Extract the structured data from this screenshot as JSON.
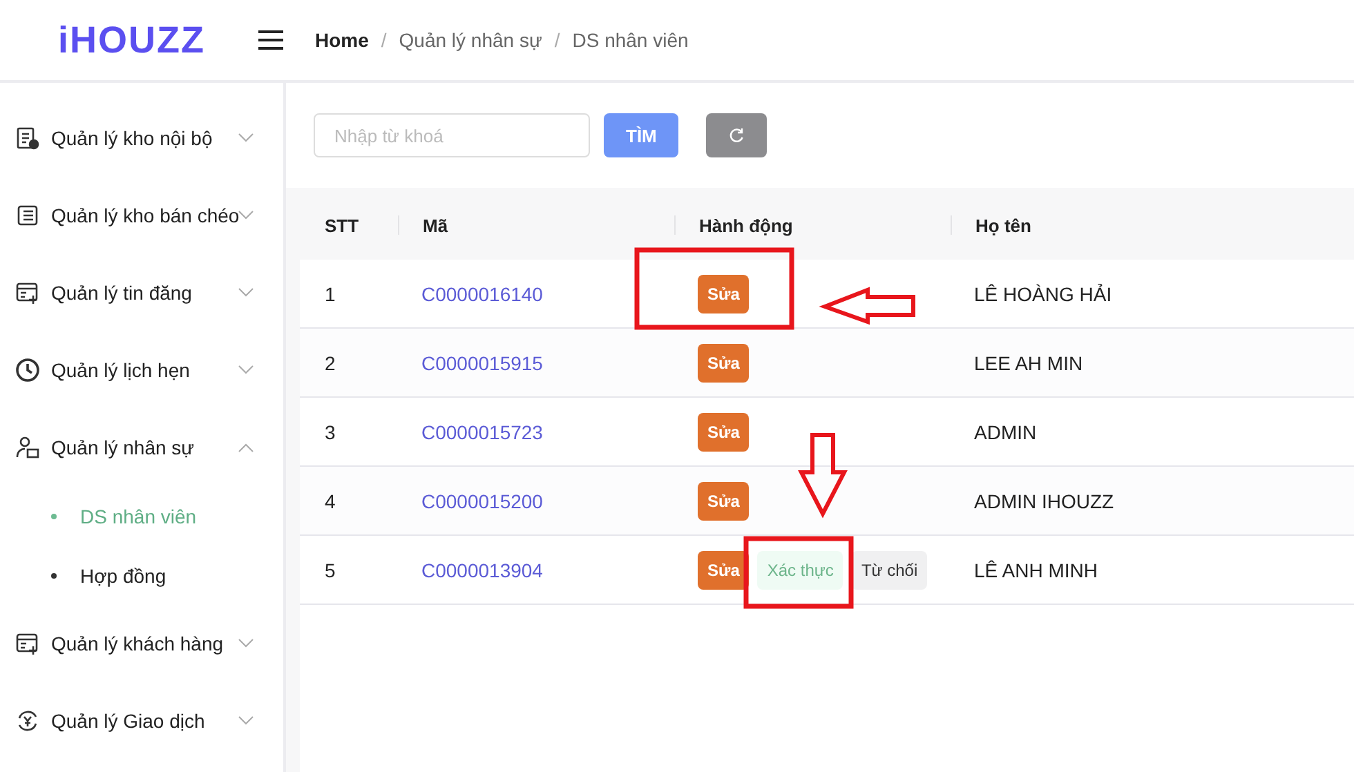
{
  "header": {
    "logo": "iHOUZZ",
    "breadcrumb": [
      {
        "kind": "root",
        "label": "Home"
      },
      {
        "kind": "separator",
        "label": "/"
      },
      {
        "kind": "link",
        "label": "Quản lý nhân sự"
      },
      {
        "kind": "separator",
        "label": "/"
      },
      {
        "kind": "link",
        "label": "DS nhân viên"
      }
    ]
  },
  "sidebar": {
    "items": [
      {
        "label": "Quản lý kho nội bộ",
        "kind": "document",
        "expanded": false
      },
      {
        "label": "Quản lý kho bán chéo",
        "kind": "list",
        "expanded": false
      },
      {
        "label": "Quản lý tin đăng",
        "kind": "calendar",
        "expanded": false
      },
      {
        "label": "Quản lý lịch hẹn",
        "kind": "clock",
        "expanded": false
      },
      {
        "label": "Quản lý nhân sự",
        "kind": "person",
        "expanded": true,
        "children": [
          {
            "label": "DS nhân viên",
            "selected": true
          },
          {
            "label": "Hợp đồng",
            "selected": false
          }
        ]
      },
      {
        "label": "Quản lý khách hàng",
        "kind": "calendar",
        "expanded": false
      },
      {
        "label": "Quản lý Giao dịch",
        "kind": "exchange",
        "expanded": false
      }
    ]
  },
  "search": {
    "placeholder": "Nhập từ khoá",
    "button": "TÌM"
  },
  "table": {
    "columns": [
      "STT",
      "Mã",
      "Hành động",
      "Họ tên"
    ],
    "rows": [
      {
        "stt": "1",
        "code": "C0000016140",
        "actions": [
          {
            "kind": "edit",
            "label": "Sửa"
          }
        ],
        "name": "LÊ HOÀNG HẢI"
      },
      {
        "stt": "2",
        "code": "C0000015915",
        "actions": [
          {
            "kind": "edit",
            "label": "Sửa"
          }
        ],
        "name": "LEE AH MIN"
      },
      {
        "stt": "3",
        "code": "C0000015723",
        "actions": [
          {
            "kind": "edit",
            "label": "Sửa"
          }
        ],
        "name": "ADMIN"
      },
      {
        "stt": "4",
        "code": "C0000015200",
        "actions": [
          {
            "kind": "edit",
            "label": "Sửa"
          }
        ],
        "name": "ADMIN IHOUZZ"
      },
      {
        "stt": "5",
        "code": "C0000013904",
        "actions": [
          {
            "kind": "edit",
            "label": "Sửa"
          },
          {
            "kind": "verify",
            "label": "Xác thực"
          },
          {
            "kind": "reject",
            "label": "Từ chối"
          }
        ],
        "name": "LÊ ANH MINH"
      }
    ]
  }
}
